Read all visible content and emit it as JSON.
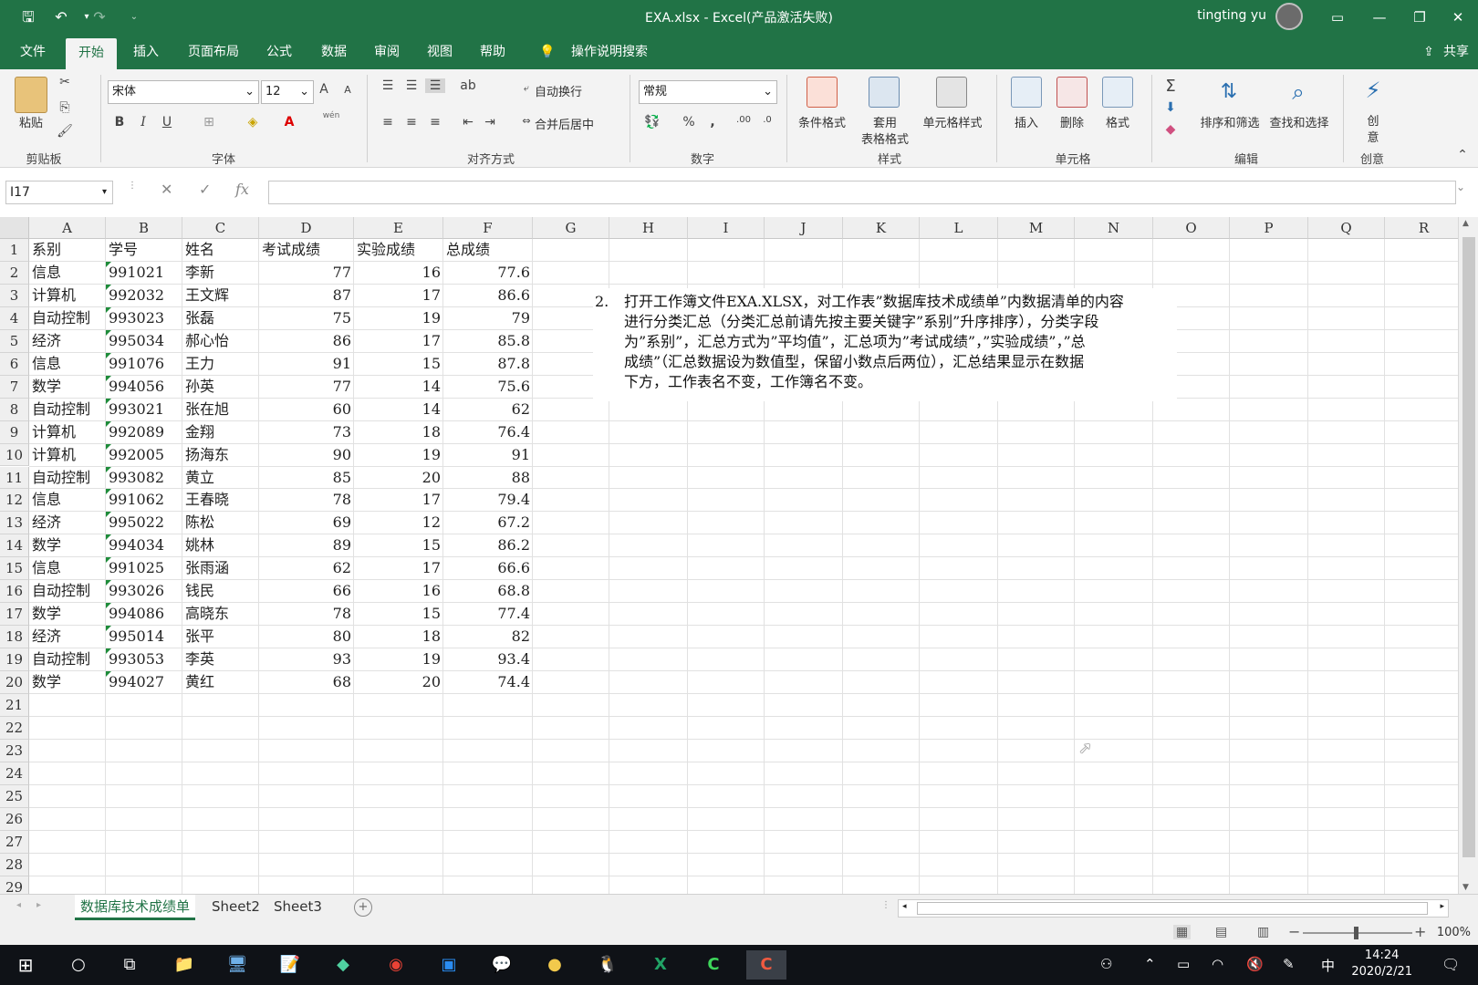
{
  "window": {
    "title": "EXA.xlsx  -  Excel(产品激活失败)",
    "user": "tingting yu"
  },
  "menu": {
    "items": [
      "文件",
      "开始",
      "插入",
      "页面布局",
      "公式",
      "数据",
      "审阅",
      "视图",
      "帮助"
    ],
    "active": "开始",
    "tell_me": "操作说明搜索",
    "share": "共享"
  },
  "ribbon": {
    "clipboard": {
      "paste": "粘贴",
      "group": "剪贴板"
    },
    "font": {
      "name": "宋体",
      "size": "12",
      "group": "字体",
      "phonetic": "wén"
    },
    "alignment": {
      "wrap": "自动换行",
      "merge": "合并后居中",
      "group": "对齐方式"
    },
    "number": {
      "format": "常规",
      "group": "数字"
    },
    "styles": {
      "conditional": "条件格式",
      "table_line1": "套用",
      "table_line2": "表格格式",
      "cell_styles": "单元格样式",
      "group": "样式"
    },
    "cells": {
      "insert": "插入",
      "delete": "删除",
      "format": "格式",
      "group": "单元格"
    },
    "editing": {
      "sort": "排序和筛选",
      "find": "查找和选择",
      "group": "编辑"
    },
    "ideas": {
      "line1": "创",
      "line2": "意",
      "group": "创意"
    }
  },
  "formula_bar": {
    "name_box": "I17",
    "formula": ""
  },
  "columns": [
    "A",
    "B",
    "C",
    "D",
    "E",
    "F",
    "G",
    "H",
    "I",
    "J",
    "K",
    "L",
    "M",
    "N",
    "O",
    "P",
    "Q",
    "R"
  ],
  "rows": [
    "1",
    "2",
    "3",
    "4",
    "5",
    "6",
    "7",
    "8",
    "9",
    "10",
    "11",
    "12",
    "13",
    "14",
    "15",
    "16",
    "17",
    "18",
    "19",
    "20",
    "21",
    "22",
    "23",
    "24",
    "25",
    "26",
    "27",
    "28",
    "29"
  ],
  "table": {
    "headers": [
      "系别",
      "学号",
      "姓名",
      "考试成绩",
      "实验成绩",
      "总成绩"
    ],
    "data": [
      [
        "信息",
        "991021",
        "李新",
        "77",
        "16",
        "77.6"
      ],
      [
        "计算机",
        "992032",
        "王文辉",
        "87",
        "17",
        "86.6"
      ],
      [
        "自动控制",
        "993023",
        "张磊",
        "75",
        "19",
        "79"
      ],
      [
        "经济",
        "995034",
        "郝心怡",
        "86",
        "17",
        "85.8"
      ],
      [
        "信息",
        "991076",
        "王力",
        "91",
        "15",
        "87.8"
      ],
      [
        "数学",
        "994056",
        "孙英",
        "77",
        "14",
        "75.6"
      ],
      [
        "自动控制",
        "993021",
        "张在旭",
        "60",
        "14",
        "62"
      ],
      [
        "计算机",
        "992089",
        "金翔",
        "73",
        "18",
        "76.4"
      ],
      [
        "计算机",
        "992005",
        "扬海东",
        "90",
        "19",
        "91"
      ],
      [
        "自动控制",
        "993082",
        "黄立",
        "85",
        "20",
        "88"
      ],
      [
        "信息",
        "991062",
        "王春晓",
        "78",
        "17",
        "79.4"
      ],
      [
        "经济",
        "995022",
        "陈松",
        "69",
        "12",
        "67.2"
      ],
      [
        "数学",
        "994034",
        "姚林",
        "89",
        "15",
        "86.2"
      ],
      [
        "信息",
        "991025",
        "张雨涵",
        "62",
        "17",
        "66.6"
      ],
      [
        "自动控制",
        "993026",
        "钱民",
        "66",
        "16",
        "68.8"
      ],
      [
        "数学",
        "994086",
        "高晓东",
        "78",
        "15",
        "77.4"
      ],
      [
        "经济",
        "995014",
        "张平",
        "80",
        "18",
        "82"
      ],
      [
        "自动控制",
        "993053",
        "李英",
        "93",
        "19",
        "93.4"
      ],
      [
        "数学",
        "994027",
        "黄红",
        "68",
        "20",
        "74.4"
      ]
    ]
  },
  "note": {
    "number": "2.",
    "lines": [
      "打开工作簿文件EXA.XLSX，对工作表”数据库技术成绩单”内数据清单的内容",
      "进行分类汇总（分类汇总前请先按主要关键字”系别”升序排序），分类字段",
      "为”系别”，汇总方式为”平均值”，汇总项为”考试成绩”，”实验成绩”，”总",
      "成绩”（汇总数据设为数值型，保留小数点后两位），汇总结果显示在数据",
      "下方，工作表名不变，工作簿名不变。"
    ]
  },
  "sheets": [
    "数据库技术成绩单",
    "Sheet2",
    "Sheet3"
  ],
  "active_sheet": "数据库技术成绩单",
  "status": {
    "zoom": "100%"
  },
  "taskbar": {
    "time": "14:24",
    "date": "2020/2/21",
    "ime": "中"
  },
  "colors": {
    "excel_green": "#217346",
    "taskbar": "#0f1217",
    "ribbon_bg": "#f3f3f3"
  }
}
